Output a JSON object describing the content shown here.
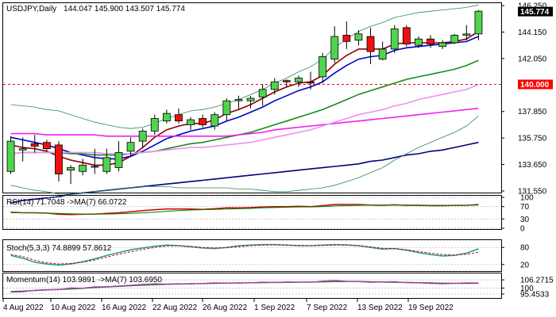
{
  "chart_data": [
    {
      "type": "candlestick",
      "title": "USDJPY,Daily",
      "ohlc_text": "144.047 145.900 143.507 145.774",
      "ylim": [
        131.55,
        146.25
      ],
      "y_ticks": [
        "146.250",
        "144.150",
        "142.050",
        "137.850",
        "135.750",
        "133.650",
        "131.550"
      ],
      "current_price": "145.774",
      "level_line": "140.000",
      "colors": {
        "up": "#4fd44f",
        "down": "#ee1111",
        "level": "#dd1111",
        "price_box": "#000000",
        "level_box": "#ff0000"
      },
      "candles": [
        {
          "o": 133.1,
          "h": 135.9,
          "l": 132.9,
          "c": 135.5
        },
        {
          "o": 134.8,
          "h": 135.8,
          "l": 133.9,
          "c": 134.9
        },
        {
          "o": 135.3,
          "h": 136.0,
          "l": 134.6,
          "c": 135.1
        },
        {
          "o": 135.4,
          "h": 135.6,
          "l": 134.7,
          "c": 134.9
        },
        {
          "o": 135.2,
          "h": 135.5,
          "l": 132.3,
          "c": 132.9
        },
        {
          "o": 133.2,
          "h": 133.6,
          "l": 132.1,
          "c": 133.4
        },
        {
          "o": 133.1,
          "h": 134.1,
          "l": 132.8,
          "c": 133.6
        },
        {
          "o": 133.5,
          "h": 134.9,
          "l": 132.9,
          "c": 133.5
        },
        {
          "o": 133.1,
          "h": 134.9,
          "l": 132.9,
          "c": 134.2
        },
        {
          "o": 133.4,
          "h": 135.5,
          "l": 133.1,
          "c": 134.6
        },
        {
          "o": 134.7,
          "h": 135.8,
          "l": 134.3,
          "c": 135.4
        },
        {
          "o": 135.5,
          "h": 136.5,
          "l": 135.0,
          "c": 136.3
        },
        {
          "o": 136.3,
          "h": 137.6,
          "l": 136.0,
          "c": 137.3
        },
        {
          "o": 137.1,
          "h": 138.0,
          "l": 136.9,
          "c": 137.7
        },
        {
          "o": 137.6,
          "h": 138.1,
          "l": 136.9,
          "c": 137.1
        },
        {
          "o": 136.8,
          "h": 137.4,
          "l": 136.4,
          "c": 137.2
        },
        {
          "o": 137.3,
          "h": 137.6,
          "l": 136.6,
          "c": 136.8
        },
        {
          "o": 136.7,
          "h": 137.8,
          "l": 136.4,
          "c": 137.6
        },
        {
          "o": 137.6,
          "h": 138.9,
          "l": 137.1,
          "c": 138.7
        },
        {
          "o": 138.7,
          "h": 139.1,
          "l": 138.0,
          "c": 138.8
        },
        {
          "o": 138.7,
          "h": 139.1,
          "l": 138.1,
          "c": 138.9
        },
        {
          "o": 139.0,
          "h": 140.0,
          "l": 138.3,
          "c": 139.6
        },
        {
          "o": 139.6,
          "h": 140.5,
          "l": 139.2,
          "c": 140.2
        },
        {
          "o": 140.3,
          "h": 140.4,
          "l": 139.8,
          "c": 140.2
        },
        {
          "o": 140.2,
          "h": 140.7,
          "l": 139.8,
          "c": 140.5
        },
        {
          "o": 140.2,
          "h": 141.0,
          "l": 139.6,
          "c": 140.1
        },
        {
          "o": 140.6,
          "h": 142.5,
          "l": 140.1,
          "c": 142.2
        },
        {
          "o": 142.0,
          "h": 144.6,
          "l": 141.7,
          "c": 143.8
        },
        {
          "o": 143.9,
          "h": 145.0,
          "l": 142.8,
          "c": 143.4
        },
        {
          "o": 143.5,
          "h": 144.3,
          "l": 143.1,
          "c": 144.0
        },
        {
          "o": 143.8,
          "h": 144.5,
          "l": 141.6,
          "c": 142.6
        },
        {
          "o": 142.0,
          "h": 143.4,
          "l": 141.9,
          "c": 142.8
        },
        {
          "o": 142.8,
          "h": 144.7,
          "l": 142.5,
          "c": 144.4
        },
        {
          "o": 144.5,
          "h": 144.7,
          "l": 143.0,
          "c": 143.2
        },
        {
          "o": 143.1,
          "h": 143.8,
          "l": 142.9,
          "c": 143.6
        },
        {
          "o": 143.6,
          "h": 143.9,
          "l": 142.9,
          "c": 143.2
        },
        {
          "o": 143.0,
          "h": 143.5,
          "l": 142.8,
          "c": 143.3
        },
        {
          "o": 143.3,
          "h": 144.0,
          "l": 143.2,
          "c": 143.9
        },
        {
          "o": 143.9,
          "h": 144.7,
          "l": 143.5,
          "c": 144.0
        },
        {
          "o": 144.0,
          "h": 145.9,
          "l": 143.5,
          "c": 145.8
        }
      ],
      "overlays": [
        {
          "name": "ema-fast",
          "color": "#8b0000",
          "values": [
            135.2,
            135.0,
            134.9,
            134.7,
            134.3,
            134.0,
            133.8,
            133.6,
            133.6,
            133.8,
            134.3,
            135.0,
            135.8,
            136.4,
            136.7,
            136.9,
            136.9,
            137.2,
            137.7,
            138.0,
            138.4,
            138.9,
            139.4,
            139.8,
            140.1,
            140.2,
            140.7,
            141.6,
            142.3,
            142.8,
            142.8,
            142.8,
            143.2,
            143.3,
            143.3,
            143.3,
            143.3,
            143.4,
            143.6,
            144.2
          ]
        },
        {
          "name": "ema-10",
          "color": "#0000cc",
          "values": [
            135.8,
            135.6,
            135.4,
            135.2,
            134.9,
            134.6,
            134.4,
            134.2,
            134.1,
            134.1,
            134.3,
            134.7,
            135.2,
            135.7,
            136.0,
            136.3,
            136.5,
            136.7,
            137.1,
            137.4,
            137.8,
            138.2,
            138.7,
            139.1,
            139.5,
            139.8,
            140.2,
            140.9,
            141.5,
            142.0,
            142.2,
            142.3,
            142.7,
            142.9,
            143.0,
            143.1,
            143.2,
            143.3,
            143.4,
            143.8
          ]
        },
        {
          "name": "sma-20",
          "color": "#1a8a1a",
          "values": [
            134.5,
            134.6,
            134.6,
            134.6,
            134.6,
            134.5,
            134.5,
            134.4,
            134.4,
            134.4,
            134.5,
            134.6,
            134.7,
            134.9,
            135.1,
            135.3,
            135.4,
            135.6,
            135.8,
            136.0,
            136.2,
            136.5,
            136.8,
            137.1,
            137.4,
            137.7,
            138.0,
            138.4,
            138.8,
            139.2,
            139.5,
            139.8,
            140.1,
            140.4,
            140.6,
            140.8,
            141.0,
            141.2,
            141.5,
            141.9
          ]
        },
        {
          "name": "ma-magenta",
          "color": "#ee22ee",
          "values": [
            136.1,
            136.1,
            136.1,
            136.0,
            136.0,
            136.0,
            136.0,
            136.0,
            135.9,
            135.9,
            135.9,
            135.9,
            135.9,
            135.9,
            135.9,
            135.9,
            135.9,
            135.9,
            135.9,
            136.0,
            136.1,
            136.2,
            136.4,
            136.5,
            136.6,
            136.7,
            136.8,
            136.9,
            137.0,
            137.1,
            137.2,
            137.3,
            137.4,
            137.5,
            137.6,
            137.7,
            137.8,
            137.9,
            138.0,
            138.1
          ]
        },
        {
          "name": "ma-pink",
          "color": "#f090f0",
          "values": [
            134.5,
            134.6,
            134.6,
            134.6,
            134.6,
            134.6,
            134.6,
            134.6,
            134.5,
            134.5,
            134.5,
            134.6,
            134.7,
            134.8,
            134.9,
            135.0,
            135.0,
            135.1,
            135.2,
            135.3,
            135.4,
            135.6,
            135.8,
            136.0,
            136.2,
            136.4,
            136.7,
            137.0,
            137.3,
            137.6,
            137.8,
            138.0,
            138.3,
            138.5,
            138.8,
            139.0,
            139.2,
            139.4,
            139.6,
            140.0
          ]
        },
        {
          "name": "ma-navy",
          "color": "#000080",
          "values": [
            130.6,
            130.8,
            130.9,
            131.0,
            131.1,
            131.3,
            131.4,
            131.5,
            131.6,
            131.7,
            131.8,
            131.9,
            132.0,
            132.1,
            132.2,
            132.3,
            132.4,
            132.5,
            132.6,
            132.7,
            132.8,
            132.9,
            133.0,
            133.1,
            133.2,
            133.3,
            133.4,
            133.5,
            133.6,
            133.7,
            133.9,
            134.0,
            134.2,
            134.4,
            134.5,
            134.7,
            134.8,
            135.0,
            135.2,
            135.4
          ]
        },
        {
          "name": "bb-upper",
          "color": "#2e8b57",
          "values": [
            138.4,
            138.3,
            138.2,
            138.0,
            137.9,
            137.6,
            137.3,
            137.0,
            136.8,
            136.6,
            136.5,
            136.6,
            136.9,
            137.3,
            137.6,
            137.9,
            138.0,
            138.2,
            138.5,
            138.8,
            139.2,
            139.6,
            140.1,
            140.5,
            141.0,
            141.4,
            142.0,
            142.9,
            143.6,
            144.2,
            144.6,
            144.9,
            145.3,
            145.5,
            145.7,
            145.8,
            145.9,
            146.0,
            146.1,
            146.3
          ]
        },
        {
          "name": "bb-lower",
          "color": "#2e8b57",
          "values": [
            132.0,
            131.8,
            131.6,
            131.5,
            131.3,
            131.3,
            131.4,
            131.5,
            131.6,
            131.7,
            131.8,
            131.9,
            131.9,
            131.9,
            131.8,
            131.8,
            131.8,
            131.8,
            131.8,
            131.7,
            131.7,
            131.6,
            131.5,
            131.5,
            131.6,
            131.7,
            131.8,
            132.0,
            132.3,
            132.6,
            133.0,
            133.4,
            134.0,
            134.5,
            135.0,
            135.4,
            135.8,
            136.2,
            136.7,
            137.5
          ]
        }
      ],
      "x_labels": [
        "4 Aug 2022",
        "10 Aug 2022",
        "16 Aug 2022",
        "22 Aug 2022",
        "26 Aug 2022",
        "1 Sep 2022",
        "7 Sep 2022",
        "13 Sep 2022",
        "19 Sep 2022"
      ]
    },
    {
      "type": "line",
      "title": "RSI(14) 71.7048 ->MA(7) 66.0722",
      "ylim": [
        0,
        100
      ],
      "y_ticks": [
        "100",
        "70",
        "30",
        "0"
      ],
      "series": [
        {
          "color": "#cc0000",
          "values": [
            52,
            50,
            50,
            49,
            45,
            44,
            45,
            46,
            48,
            50,
            53,
            57,
            60,
            62,
            62,
            62,
            61,
            63,
            66,
            66,
            67,
            69,
            70,
            70,
            71,
            70,
            73,
            77,
            77,
            77,
            75,
            74,
            76,
            74,
            74,
            73,
            73,
            74,
            74,
            77
          ]
        },
        {
          "color": "#008000",
          "values": [
            50,
            50,
            50,
            49,
            48,
            47,
            46,
            46,
            46,
            47,
            48,
            50,
            52,
            55,
            57,
            59,
            60,
            61,
            62,
            63,
            64,
            66,
            67,
            68,
            69,
            69,
            70,
            72,
            73,
            74,
            75,
            75,
            75,
            75,
            75,
            74,
            74,
            74,
            74,
            75
          ]
        }
      ]
    },
    {
      "type": "line",
      "title": "Stoch(5,3,3) 74.8899 57.8612",
      "ylim": [
        0,
        100
      ],
      "y_ticks": [
        "80",
        "20"
      ],
      "series": [
        {
          "color": "#1a9a9a",
          "values": [
            52,
            42,
            28,
            22,
            18,
            22,
            30,
            40,
            52,
            62,
            72,
            78,
            84,
            88,
            86,
            82,
            78,
            76,
            80,
            86,
            88,
            90,
            90,
            88,
            86,
            86,
            88,
            90,
            89,
            86,
            80,
            74,
            76,
            70,
            62,
            55,
            50,
            52,
            60,
            75
          ]
        },
        {
          "color": "#cc0000",
          "values": [
            55,
            48,
            35,
            26,
            22,
            24,
            28,
            36,
            46,
            56,
            65,
            73,
            80,
            85,
            86,
            84,
            80,
            78,
            79,
            82,
            86,
            88,
            89,
            88,
            87,
            86,
            87,
            88,
            88,
            86,
            82,
            77,
            76,
            72,
            66,
            60,
            55,
            53,
            56,
            63
          ]
        }
      ]
    },
    {
      "type": "line",
      "title": "Momentum(14) 103.9891 ->MA(7) 103.6950",
      "ylim": [
        93,
        110
      ],
      "y_ticks": [
        "106.2715",
        "100",
        "95.4533"
      ],
      "series": [
        {
          "color": "#2e7d2e",
          "values": [
            97.3,
            97.6,
            98.1,
            98.6,
            98.9,
            99.3,
            99.8,
            100.4,
            100.9,
            101.3,
            101.8,
            102.2,
            102.6,
            102.9,
            103.1,
            103.3,
            103.5,
            103.6,
            103.8,
            103.9,
            104.1,
            104.2,
            104.3,
            104.4,
            104.5,
            104.6,
            104.8,
            105.0,
            105.1,
            105.0,
            104.8,
            104.6,
            104.5,
            104.3,
            104.1,
            103.9,
            103.7,
            103.6,
            103.6,
            103.7
          ]
        },
        {
          "color": "#cc22cc",
          "values": [
            96.8,
            97.0,
            98.4,
            98.8,
            98.7,
            100.2,
            99.9,
            101.0,
            101.1,
            101.6,
            102.3,
            102.9,
            103.3,
            103.1,
            103.4,
            103.0,
            103.6,
            104.1,
            103.9,
            103.7,
            104.2,
            104.6,
            104.3,
            104.8,
            104.6,
            104.5,
            105.4,
            105.9,
            105.2,
            104.9,
            104.3,
            104.8,
            104.9,
            104.1,
            103.9,
            103.5,
            103.2,
            103.6,
            104.1,
            104.0
          ]
        }
      ]
    }
  ]
}
